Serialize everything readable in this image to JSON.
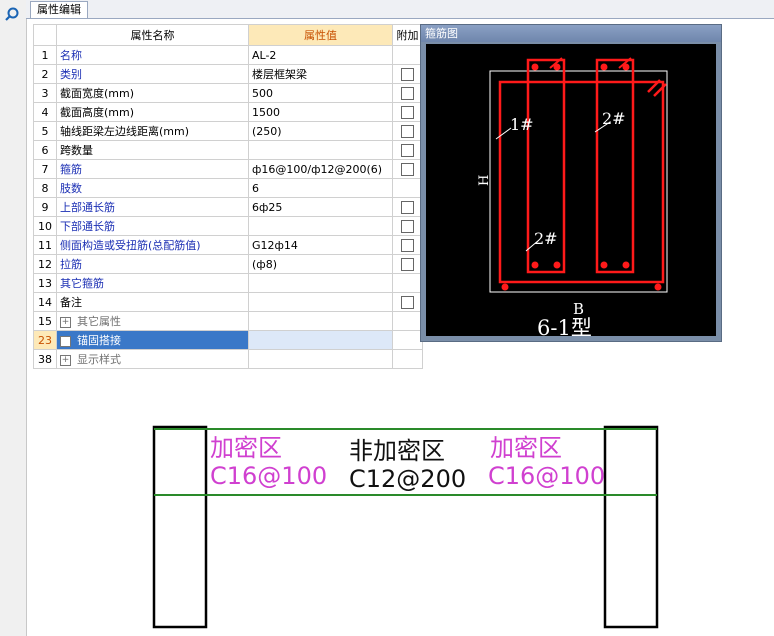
{
  "tab": {
    "label": "属性编辑"
  },
  "grid": {
    "headers": {
      "name": "属性名称",
      "value": "属性值",
      "extra": "附加"
    },
    "rows": [
      {
        "num": "1",
        "name": "名称",
        "value": "AL-2",
        "style": "blue",
        "check": false
      },
      {
        "num": "2",
        "name": "类别",
        "value": "楼层框架梁",
        "style": "blue",
        "check": true
      },
      {
        "num": "3",
        "name": "截面宽度(mm)",
        "value": "500",
        "style": "black",
        "check": true
      },
      {
        "num": "4",
        "name": "截面高度(mm)",
        "value": "1500",
        "style": "black",
        "check": true
      },
      {
        "num": "5",
        "name": "轴线距梁左边线距离(mm)",
        "value": "(250)",
        "style": "black",
        "check": true
      },
      {
        "num": "6",
        "name": "跨数量",
        "value": "",
        "style": "black",
        "check": true
      },
      {
        "num": "7",
        "name": "箍筋",
        "value": "ф16@100/ф12@200(6)",
        "style": "blue",
        "check": true
      },
      {
        "num": "8",
        "name": "肢数",
        "value": "6",
        "style": "blue",
        "check": false
      },
      {
        "num": "9",
        "name": "上部通长筋",
        "value": "6ф25",
        "style": "blue",
        "check": true
      },
      {
        "num": "10",
        "name": "下部通长筋",
        "value": "",
        "style": "blue",
        "check": true
      },
      {
        "num": "11",
        "name": "侧面构造或受扭筋(总配筋值)",
        "value": "G12ф14",
        "style": "blue",
        "check": true
      },
      {
        "num": "12",
        "name": "拉筋",
        "value": "(ф8)",
        "style": "blue",
        "check": true
      },
      {
        "num": "13",
        "name": "其它箍筋",
        "value": "",
        "style": "blue",
        "check": false
      },
      {
        "num": "14",
        "name": "备注",
        "value": "",
        "style": "black",
        "check": true
      }
    ],
    "groups": [
      {
        "num": "15",
        "name": "其它属性",
        "style": "grey",
        "selected": false
      },
      {
        "num": "23",
        "name": "锚固搭接",
        "style": "sel",
        "selected": true
      },
      {
        "num": "38",
        "name": "显示样式",
        "style": "grey",
        "selected": false
      }
    ]
  },
  "popup": {
    "title": "箍筋图",
    "labels": {
      "tag1": "1#",
      "tag2a": "2#",
      "tag2b": "2#",
      "h": "H",
      "b": "B",
      "type": "6-1型"
    }
  },
  "sketch": {
    "left_zone": {
      "title": "加密区",
      "spec": "C16@100"
    },
    "mid_zone": {
      "title": "非加密区",
      "spec": "C12@200"
    },
    "right_zone": {
      "title": "加密区",
      "spec": "C16@100"
    },
    "colors": {
      "dense": "#d040d0",
      "normal": "#111111",
      "beam_line": "#2a8a2a",
      "rebar": "#ff1a1a"
    }
  }
}
